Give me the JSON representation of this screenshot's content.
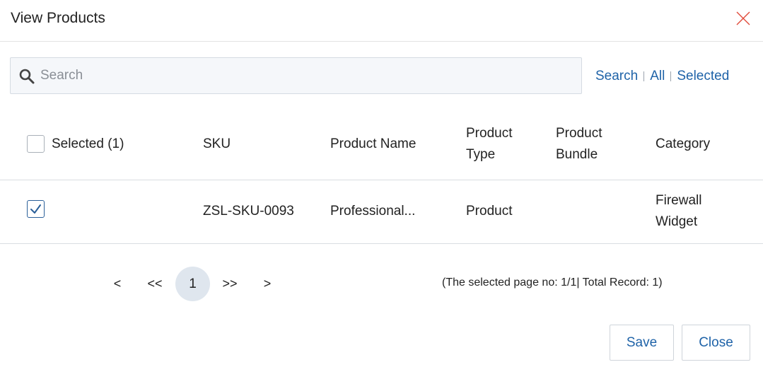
{
  "dialog": {
    "title": "View Products"
  },
  "search": {
    "placeholder": "Search"
  },
  "filters": {
    "search": "Search",
    "all": "All",
    "selected": "Selected"
  },
  "table": {
    "headers": {
      "selected": "Selected (1)",
      "sku": "SKU",
      "product_name": "Product Name",
      "product_type_line1": "Product",
      "product_type_line2": "Type",
      "product_bundle_line1": "Product",
      "product_bundle_line2": "Bundle",
      "category": "Category"
    },
    "rows": [
      {
        "checked": true,
        "sku": "ZSL-SKU-0093",
        "product_name": "Professional...",
        "product_type": "Product",
        "product_bundle": "",
        "category_line1": "Firewall",
        "category_line2": "Widget"
      }
    ]
  },
  "pagination": {
    "prev": "<",
    "first": "<<",
    "current": "1",
    "last": ">>",
    "next": ">",
    "info": "(The selected page no: 1/1| Total Record: 1)"
  },
  "buttons": {
    "save": "Save",
    "close": "Close"
  },
  "colors": {
    "accent": "#1f63a8",
    "close_icon": "#e04a3a",
    "current_page_bg": "#dfe6ee"
  }
}
